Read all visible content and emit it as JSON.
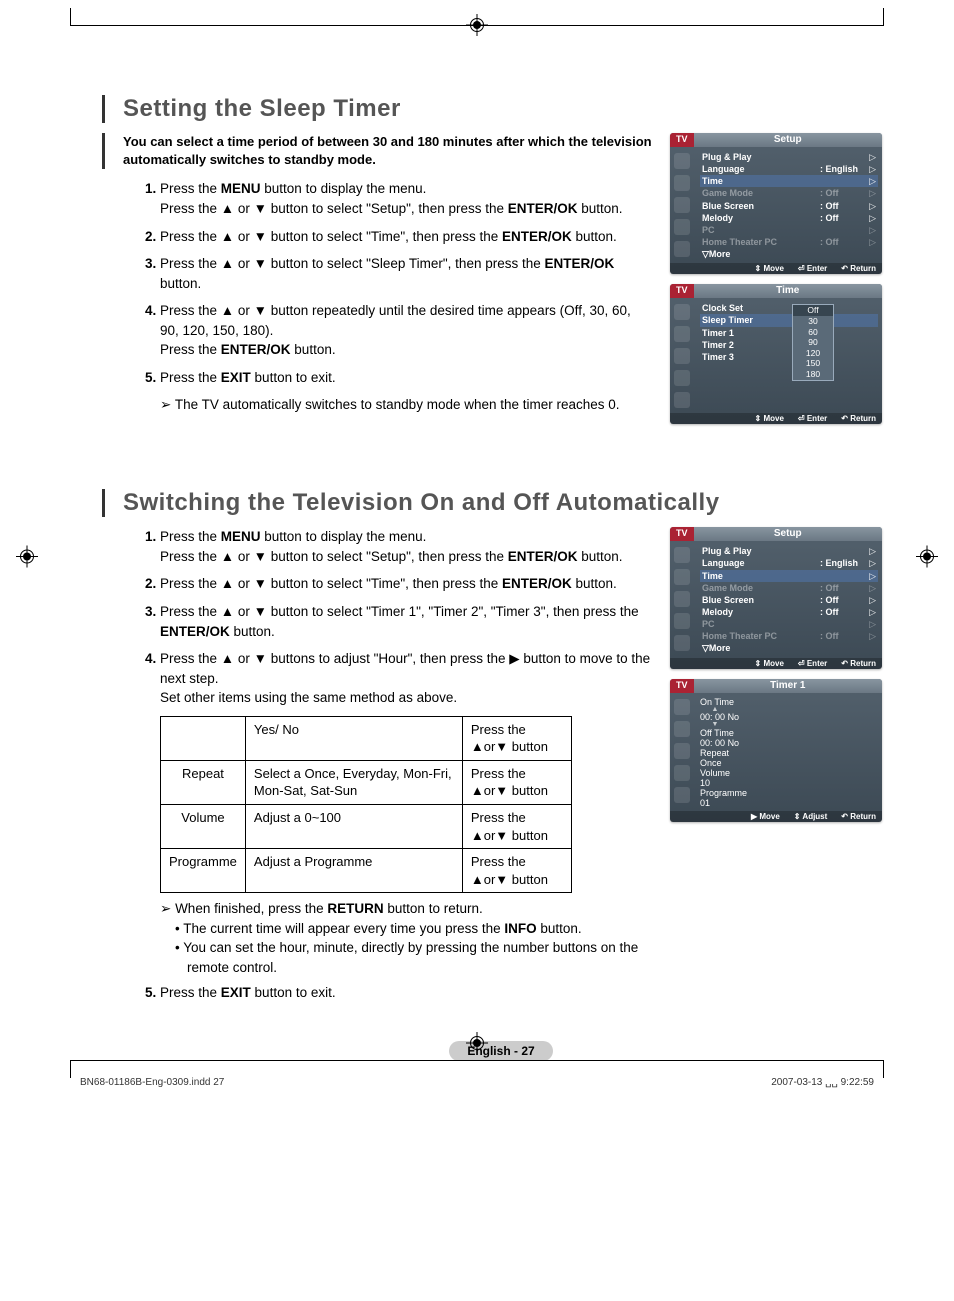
{
  "section1": {
    "title": "Setting the Sleep Timer",
    "intro": "You can select a time period of between 30 and 180 minutes after which the television automatically switches to standby mode.",
    "steps": [
      "Press the <b>MENU</b> button to display the menu.<br>Press the ▲ or ▼ button to select \"Setup\", then press the <b>ENTER/OK</b> button.",
      "Press the ▲ or ▼ button to select \"Time\", then press the <b>ENTER/OK</b> button.",
      "Press the ▲ or ▼ button to select \"Sleep Timer\", then press the <b>ENTER/OK</b> button.",
      "Press the ▲ or ▼ button repeatedly until the desired time appears (Off, 30, 60, 90, 120, 150, 180).<br>Press the <b>ENTER/OK</b> button.",
      "Press the <b>EXIT</b> button to exit."
    ],
    "note": "The TV automatically switches to standby mode when the timer reaches 0."
  },
  "section2": {
    "title": "Switching the Television On and Off Automatically",
    "steps": [
      "Press the <b>MENU</b> button to display the menu.<br>Press the ▲ or ▼ button to select \"Setup\", then press the <b>ENTER/OK</b> button.",
      "Press the ▲ or ▼ button to select \"Time\", then press the <b>ENTER/OK</b> button.",
      "Press the ▲ or ▼ button to select \"Timer 1\", \"Timer 2\", \"Timer 3\", then press the <b>ENTER/OK</b> button.",
      "Press the ▲ or ▼ buttons to adjust \"Hour\", then press the ▶ button to move to the next step.<br>Set other items using the same method as above."
    ],
    "table": [
      [
        "",
        "Yes/ No",
        "Press the ▲or▼ button"
      ],
      [
        "Repeat",
        "Select a Once, Everyday, Mon-Fri, Mon-Sat, Sat-Sun",
        "Press the ▲or▼ button"
      ],
      [
        "Volume",
        "Adjust a 0~100",
        "Press the ▲or▼ button"
      ],
      [
        "Programme",
        "Adjust a Programme",
        "Press the ▲or▼ button"
      ]
    ],
    "note": "When finished, press the <b>RETURN</b> button to return.",
    "bullets": [
      "The current time will appear every time you press the <b>INFO</b> button.",
      "You can set the hour, minute, directly by pressing the number buttons on the remote control."
    ],
    "step5": "Press the <b>EXIT</b> button to exit."
  },
  "osd": {
    "tv": "TV",
    "setup": {
      "title": "Setup",
      "rows": [
        {
          "lab": "Plug & Play",
          "val": "",
          "tri": "▷",
          "dim": false
        },
        {
          "lab": "Language",
          "val": ": English",
          "tri": "▷",
          "dim": false
        },
        {
          "lab": "Time",
          "val": "",
          "tri": "▷",
          "dim": false,
          "hl": true
        },
        {
          "lab": "Game Mode",
          "val": ": Off",
          "tri": "▷",
          "dim": true
        },
        {
          "lab": "Blue Screen",
          "val": ": Off",
          "tri": "▷",
          "dim": false
        },
        {
          "lab": "Melody",
          "val": ": Off",
          "tri": "▷",
          "dim": false
        },
        {
          "lab": "PC",
          "val": "",
          "tri": "▷",
          "dim": true
        },
        {
          "lab": "Home Theater PC",
          "val": ": Off",
          "tri": "▷",
          "dim": true
        },
        {
          "lab": "▽More",
          "val": "",
          "tri": "",
          "dim": false
        }
      ],
      "footer": [
        "⇕ Move",
        "⏎ Enter",
        "↶ Return"
      ]
    },
    "time": {
      "title": "Time",
      "rows": [
        {
          "lab": "Clock Set",
          "val": ":",
          "tri": ""
        },
        {
          "lab": "Sleep Timer",
          "val": ":",
          "tri": "",
          "hl": true
        },
        {
          "lab": "Timer 1",
          "val": ":",
          "tri": ""
        },
        {
          "lab": "Timer 2",
          "val": ":",
          "tri": ""
        },
        {
          "lab": "Timer 3",
          "val": ":",
          "tri": ""
        }
      ],
      "options": [
        "Off",
        "30",
        "60",
        "90",
        "120",
        "150",
        "180"
      ],
      "footer": [
        "⇕ Move",
        "⏎ Enter",
        "↶ Return"
      ]
    },
    "setup2_hl": "Time",
    "timer1": {
      "title": "Timer 1",
      "on_time": "On Time",
      "off_time": "Off Time",
      "h": "00",
      "m": "00",
      "no": "No",
      "repeat": "Repeat",
      "once": "Once",
      "volume": "Volume",
      "vol": "10",
      "programme": "Programme",
      "prog": "01",
      "footer": [
        "▶ Move",
        "⇕ Adjust",
        "↶ Return"
      ]
    }
  },
  "page_num": "English - 27",
  "footer_left": "BN68-01186B-Eng-0309.indd   27",
  "footer_right": "2007-03-13   ␣␣ 9:22:59"
}
